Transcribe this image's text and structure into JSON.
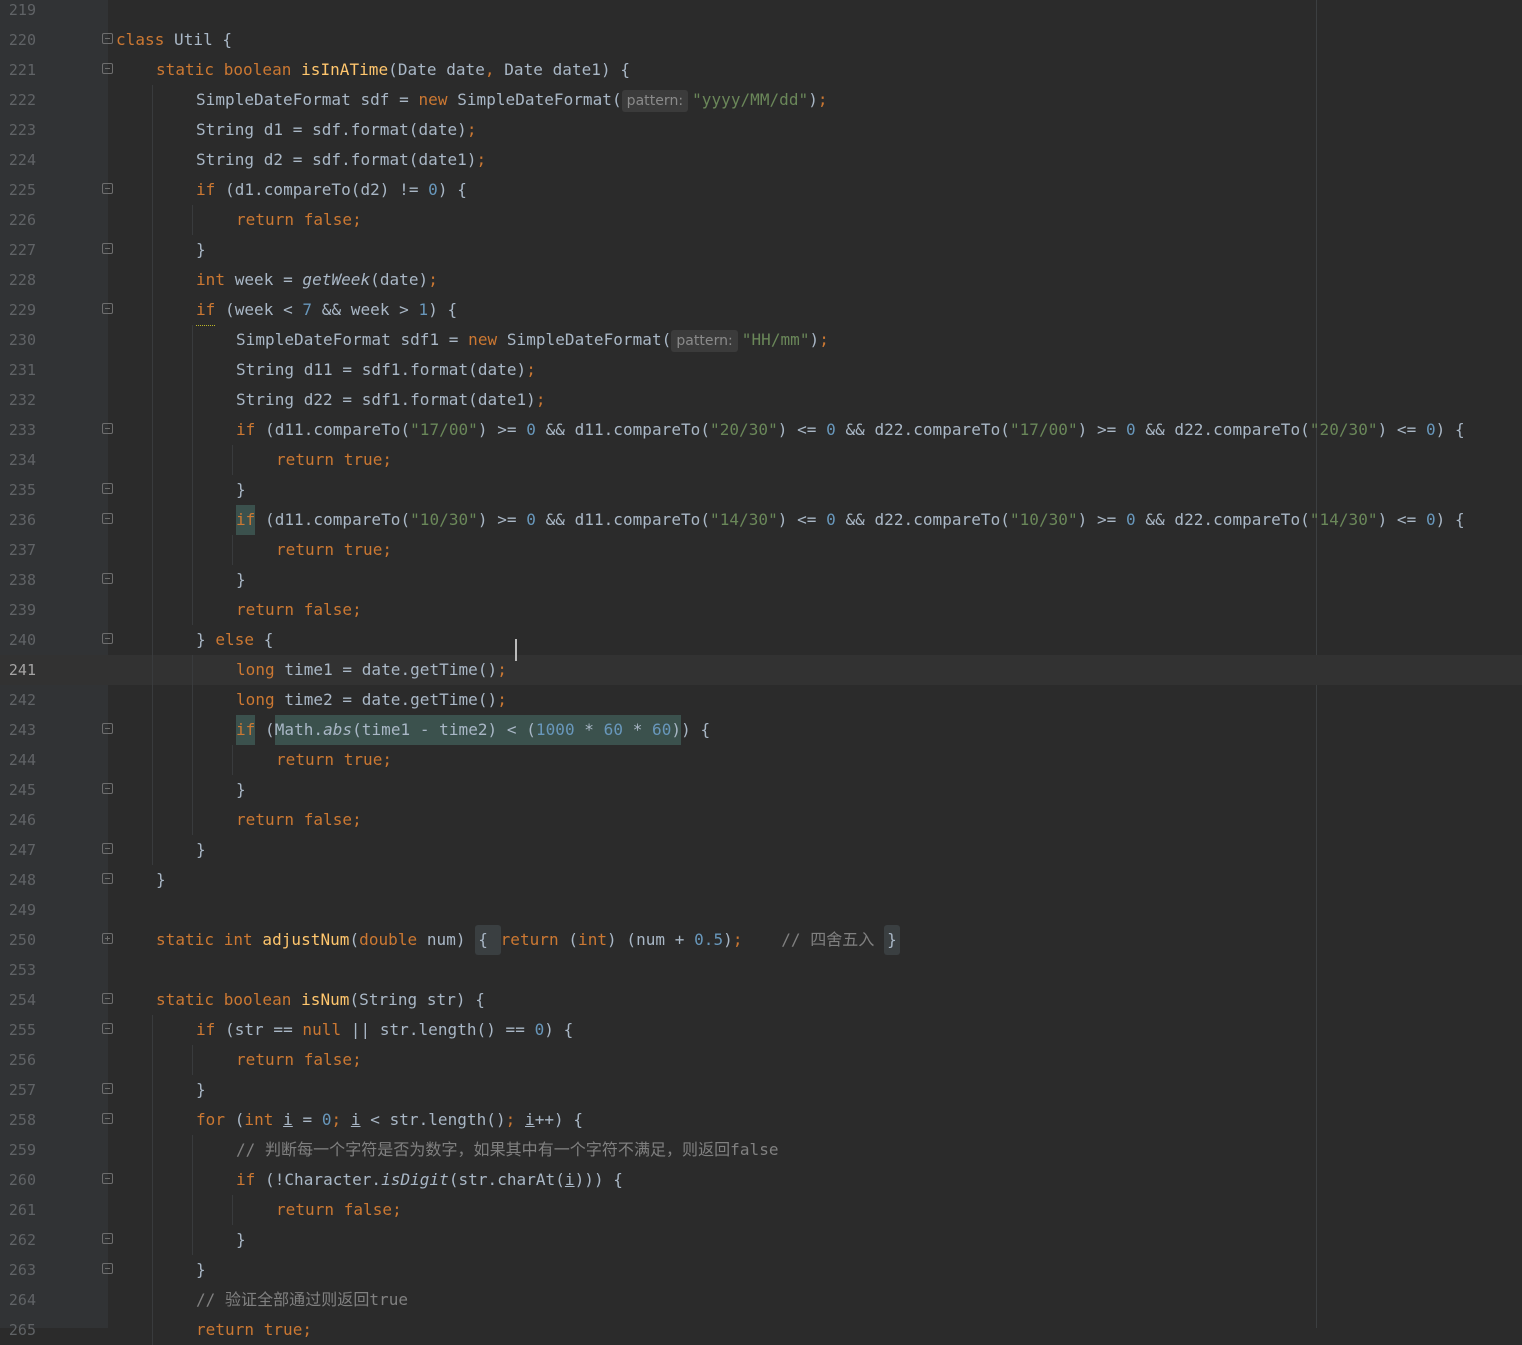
{
  "gutter_start_line": "219",
  "lines": [
    {
      "n": "219",
      "indent": 0,
      "fold": "",
      "tokens": [
        {
          "t": "",
          "c": "plain"
        }
      ]
    },
    {
      "n": "220",
      "indent": 0,
      "fold": "start",
      "tokens": [
        {
          "t": "class ",
          "c": "kw"
        },
        {
          "t": "Util {",
          "c": "plain"
        }
      ]
    },
    {
      "n": "221",
      "indent": 1,
      "fold": "start",
      "tokens": [
        {
          "t": "static boolean ",
          "c": "kw"
        },
        {
          "t": "isInATime",
          "c": "fn"
        },
        {
          "t": "(Date date",
          "c": "plain"
        },
        {
          "t": ", ",
          "c": "kw"
        },
        {
          "t": "Date date1) {",
          "c": "plain"
        }
      ]
    },
    {
      "n": "222",
      "indent": 2,
      "fold": "",
      "tokens": [
        {
          "t": "SimpleDateFormat sdf = ",
          "c": "plain"
        },
        {
          "t": "new ",
          "c": "kw"
        },
        {
          "t": "SimpleDateFormat(",
          "c": "plain"
        },
        {
          "t": "pattern:",
          "c": "hint"
        },
        {
          "t": "\"yyyy/MM/dd\"",
          "c": "str"
        },
        {
          "t": ")",
          "c": "plain"
        },
        {
          "t": ";",
          "c": "kw"
        }
      ]
    },
    {
      "n": "223",
      "indent": 2,
      "fold": "",
      "tokens": [
        {
          "t": "String d1 = sdf.format(date)",
          "c": "plain"
        },
        {
          "t": ";",
          "c": "kw"
        }
      ]
    },
    {
      "n": "224",
      "indent": 2,
      "fold": "",
      "tokens": [
        {
          "t": "String d2 = sdf.format(date1)",
          "c": "plain"
        },
        {
          "t": ";",
          "c": "kw"
        }
      ]
    },
    {
      "n": "225",
      "indent": 2,
      "fold": "start",
      "tokens": [
        {
          "t": "if ",
          "c": "kw"
        },
        {
          "t": "(d1.compareTo(d2) != ",
          "c": "plain"
        },
        {
          "t": "0",
          "c": "num"
        },
        {
          "t": ") {",
          "c": "plain"
        }
      ]
    },
    {
      "n": "226",
      "indent": 3,
      "fold": "",
      "tokens": [
        {
          "t": "return false",
          "c": "kw"
        },
        {
          "t": ";",
          "c": "kw"
        }
      ]
    },
    {
      "n": "227",
      "indent": 2,
      "fold": "end",
      "tokens": [
        {
          "t": "}",
          "c": "plain"
        }
      ]
    },
    {
      "n": "228",
      "indent": 2,
      "fold": "",
      "tokens": [
        {
          "t": "int ",
          "c": "kw"
        },
        {
          "t": "week = ",
          "c": "plain"
        },
        {
          "t": "getWeek",
          "c": "st"
        },
        {
          "t": "(date)",
          "c": "plain"
        },
        {
          "t": ";",
          "c": "kw"
        }
      ]
    },
    {
      "n": "229",
      "indent": 2,
      "fold": "start",
      "tokens": [
        {
          "t": "if",
          "c": "warn"
        },
        {
          "t": " (week < ",
          "c": "plain"
        },
        {
          "t": "7 ",
          "c": "num"
        },
        {
          "t": "&& week > ",
          "c": "plain"
        },
        {
          "t": "1",
          "c": "num"
        },
        {
          "t": ") {",
          "c": "plain"
        }
      ]
    },
    {
      "n": "230",
      "indent": 3,
      "fold": "",
      "tokens": [
        {
          "t": "SimpleDateFormat sdf1 = ",
          "c": "plain"
        },
        {
          "t": "new ",
          "c": "kw"
        },
        {
          "t": "SimpleDateFormat(",
          "c": "plain"
        },
        {
          "t": "pattern:",
          "c": "hint"
        },
        {
          "t": "\"HH/mm\"",
          "c": "str"
        },
        {
          "t": ")",
          "c": "plain"
        },
        {
          "t": ";",
          "c": "kw"
        }
      ]
    },
    {
      "n": "231",
      "indent": 3,
      "fold": "",
      "tokens": [
        {
          "t": "String d11 = sdf1.format(date)",
          "c": "plain"
        },
        {
          "t": ";",
          "c": "kw"
        }
      ]
    },
    {
      "n": "232",
      "indent": 3,
      "fold": "",
      "tokens": [
        {
          "t": "String d22 = sdf1.format(date1)",
          "c": "plain"
        },
        {
          "t": ";",
          "c": "kw"
        }
      ]
    },
    {
      "n": "233",
      "indent": 3,
      "fold": "start",
      "tokens": [
        {
          "t": "if ",
          "c": "kw"
        },
        {
          "t": "(d11.compareTo(",
          "c": "plain"
        },
        {
          "t": "\"17/00\"",
          "c": "str"
        },
        {
          "t": ") >= ",
          "c": "plain"
        },
        {
          "t": "0 ",
          "c": "num"
        },
        {
          "t": "&& d11.compareTo(",
          "c": "plain"
        },
        {
          "t": "\"20/30\"",
          "c": "str"
        },
        {
          "t": ") <= ",
          "c": "plain"
        },
        {
          "t": "0 ",
          "c": "num"
        },
        {
          "t": "&& d22.compareTo(",
          "c": "plain"
        },
        {
          "t": "\"17/00\"",
          "c": "str"
        },
        {
          "t": ") >= ",
          "c": "plain"
        },
        {
          "t": "0 ",
          "c": "num"
        },
        {
          "t": "&& d22.compareTo(",
          "c": "plain"
        },
        {
          "t": "\"20/30\"",
          "c": "str"
        },
        {
          "t": ") <= ",
          "c": "plain"
        },
        {
          "t": "0",
          "c": "num"
        },
        {
          "t": ") {",
          "c": "plain"
        }
      ]
    },
    {
      "n": "234",
      "indent": 4,
      "fold": "",
      "tokens": [
        {
          "t": "return true",
          "c": "kw"
        },
        {
          "t": ";",
          "c": "kw"
        }
      ]
    },
    {
      "n": "235",
      "indent": 3,
      "fold": "end",
      "tokens": [
        {
          "t": "}",
          "c": "plain"
        }
      ]
    },
    {
      "n": "236",
      "indent": 3,
      "fold": "start",
      "tokens": [
        {
          "t": "if",
          "c": "hlkw"
        },
        {
          "t": " (d11.compareTo(",
          "c": "plain"
        },
        {
          "t": "\"10/30\"",
          "c": "str"
        },
        {
          "t": ") >= ",
          "c": "plain"
        },
        {
          "t": "0 ",
          "c": "num"
        },
        {
          "t": "&& d11.compareTo(",
          "c": "plain"
        },
        {
          "t": "\"14/30\"",
          "c": "str"
        },
        {
          "t": ") <= ",
          "c": "plain"
        },
        {
          "t": "0 ",
          "c": "num"
        },
        {
          "t": "&& d22.compareTo(",
          "c": "plain"
        },
        {
          "t": "\"10/30\"",
          "c": "str"
        },
        {
          "t": ") >= ",
          "c": "plain"
        },
        {
          "t": "0 ",
          "c": "num"
        },
        {
          "t": "&& d22.compareTo(",
          "c": "plain"
        },
        {
          "t": "\"14/30\"",
          "c": "str"
        },
        {
          "t": ") <= ",
          "c": "plain"
        },
        {
          "t": "0",
          "c": "num"
        },
        {
          "t": ") {",
          "c": "plain"
        }
      ]
    },
    {
      "n": "237",
      "indent": 4,
      "fold": "",
      "tokens": [
        {
          "t": "return true",
          "c": "kw"
        },
        {
          "t": ";",
          "c": "kw"
        }
      ]
    },
    {
      "n": "238",
      "indent": 3,
      "fold": "end",
      "tokens": [
        {
          "t": "}",
          "c": "plain"
        }
      ]
    },
    {
      "n": "239",
      "indent": 3,
      "fold": "",
      "tokens": [
        {
          "t": "return false",
          "c": "kw"
        },
        {
          "t": ";",
          "c": "kw"
        }
      ]
    },
    {
      "n": "240",
      "indent": 2,
      "fold": "start",
      "tokens": [
        {
          "t": "} ",
          "c": "plain"
        },
        {
          "t": "else ",
          "c": "kw"
        },
        {
          "t": "{",
          "c": "plain"
        }
      ]
    },
    {
      "n": "241",
      "indent": 3,
      "fold": "",
      "current": true,
      "tokens": [
        {
          "t": "long ",
          "c": "kw"
        },
        {
          "t": "time1 = date.getTime()",
          "c": "plain"
        },
        {
          "t": ";",
          "c": "kw"
        }
      ]
    },
    {
      "n": "242",
      "indent": 3,
      "fold": "",
      "tokens": [
        {
          "t": "long ",
          "c": "kw"
        },
        {
          "t": "time2 = date.getTime()",
          "c": "plain"
        },
        {
          "t": ";",
          "c": "kw"
        }
      ]
    },
    {
      "n": "243",
      "indent": 3,
      "fold": "start",
      "tokens": [
        {
          "t": "if",
          "c": "hlkw"
        },
        {
          "t": " (",
          "c": "plain"
        },
        {
          "t": "Math.",
          "c": "hl"
        },
        {
          "t": "abs",
          "c": "hlst"
        },
        {
          "t": "(time1 - time2) < (",
          "c": "hl"
        },
        {
          "t": "1000 ",
          "c": "hln"
        },
        {
          "t": "* ",
          "c": "hl"
        },
        {
          "t": "60 ",
          "c": "hln"
        },
        {
          "t": "* ",
          "c": "hl"
        },
        {
          "t": "60",
          "c": "hln"
        },
        {
          "t": ")",
          "c": "hl"
        },
        {
          "t": ") {",
          "c": "plain"
        }
      ]
    },
    {
      "n": "244",
      "indent": 4,
      "fold": "",
      "tokens": [
        {
          "t": "return true",
          "c": "kw"
        },
        {
          "t": ";",
          "c": "kw"
        }
      ]
    },
    {
      "n": "245",
      "indent": 3,
      "fold": "end",
      "tokens": [
        {
          "t": "}",
          "c": "plain"
        }
      ]
    },
    {
      "n": "246",
      "indent": 3,
      "fold": "",
      "tokens": [
        {
          "t": "return false",
          "c": "kw"
        },
        {
          "t": ";",
          "c": "kw"
        }
      ]
    },
    {
      "n": "247",
      "indent": 2,
      "fold": "end",
      "tokens": [
        {
          "t": "}",
          "c": "plain"
        }
      ]
    },
    {
      "n": "248",
      "indent": 1,
      "fold": "end",
      "tokens": [
        {
          "t": "}",
          "c": "plain"
        }
      ]
    },
    {
      "n": "249",
      "indent": 0,
      "fold": "",
      "tokens": [
        {
          "t": "",
          "c": "plain"
        }
      ]
    },
    {
      "n": "250",
      "indent": 1,
      "fold": "collapsed",
      "tokens": [
        {
          "t": "static int ",
          "c": "kw"
        },
        {
          "t": "adjustNum",
          "c": "fn"
        },
        {
          "t": "(",
          "c": "plain"
        },
        {
          "t": "double ",
          "c": "kw"
        },
        {
          "t": "num) ",
          "c": "plain"
        },
        {
          "t": "{ ",
          "c": "fold"
        },
        {
          "t": "return ",
          "c": "kw"
        },
        {
          "t": "(",
          "c": "plain"
        },
        {
          "t": "int",
          "c": "kw"
        },
        {
          "t": ") (num + ",
          "c": "plain"
        },
        {
          "t": "0.5",
          "c": "num"
        },
        {
          "t": ")",
          "c": "plain"
        },
        {
          "t": ";    ",
          "c": "kw"
        },
        {
          "t": "// 四舍五入 ",
          "c": "comment"
        },
        {
          "t": "}",
          "c": "fold"
        }
      ]
    },
    {
      "n": "253",
      "indent": 0,
      "fold": "",
      "tokens": [
        {
          "t": "",
          "c": "plain"
        }
      ]
    },
    {
      "n": "254",
      "indent": 1,
      "fold": "start",
      "tokens": [
        {
          "t": "static boolean ",
          "c": "kw"
        },
        {
          "t": "isNum",
          "c": "fn"
        },
        {
          "t": "(String str) {",
          "c": "plain"
        }
      ]
    },
    {
      "n": "255",
      "indent": 2,
      "fold": "start",
      "tokens": [
        {
          "t": "if ",
          "c": "kw"
        },
        {
          "t": "(str == ",
          "c": "plain"
        },
        {
          "t": "null ",
          "c": "kw"
        },
        {
          "t": "|| str.length() == ",
          "c": "plain"
        },
        {
          "t": "0",
          "c": "num"
        },
        {
          "t": ") {",
          "c": "plain"
        }
      ]
    },
    {
      "n": "256",
      "indent": 3,
      "fold": "",
      "tokens": [
        {
          "t": "return false",
          "c": "kw"
        },
        {
          "t": ";",
          "c": "kw"
        }
      ]
    },
    {
      "n": "257",
      "indent": 2,
      "fold": "end",
      "tokens": [
        {
          "t": "}",
          "c": "plain"
        }
      ]
    },
    {
      "n": "258",
      "indent": 2,
      "fold": "start",
      "tokens": [
        {
          "t": "for ",
          "c": "kw"
        },
        {
          "t": "(",
          "c": "plain"
        },
        {
          "t": "int ",
          "c": "kw"
        },
        {
          "t": "i",
          "c": "uvar"
        },
        {
          "t": " = ",
          "c": "plain"
        },
        {
          "t": "0",
          "c": "num"
        },
        {
          "t": "; ",
          "c": "kw"
        },
        {
          "t": "i",
          "c": "uvar"
        },
        {
          "t": " < str.length()",
          "c": "plain"
        },
        {
          "t": "; ",
          "c": "kw"
        },
        {
          "t": "i",
          "c": "uvar"
        },
        {
          "t": "++) {",
          "c": "plain"
        }
      ]
    },
    {
      "n": "259",
      "indent": 3,
      "fold": "",
      "tokens": [
        {
          "t": "// 判断每一个字符是否为数字，如果其中有一个字符不满足，则返回false",
          "c": "comment"
        }
      ]
    },
    {
      "n": "260",
      "indent": 3,
      "fold": "start",
      "tokens": [
        {
          "t": "if ",
          "c": "kw"
        },
        {
          "t": "(!Character.",
          "c": "plain"
        },
        {
          "t": "isDigit",
          "c": "st"
        },
        {
          "t": "(str.charAt(",
          "c": "plain"
        },
        {
          "t": "i",
          "c": "uvar"
        },
        {
          "t": "))) {",
          "c": "plain"
        }
      ]
    },
    {
      "n": "261",
      "indent": 4,
      "fold": "",
      "tokens": [
        {
          "t": "return false",
          "c": "kw"
        },
        {
          "t": ";",
          "c": "kw"
        }
      ]
    },
    {
      "n": "262",
      "indent": 3,
      "fold": "end",
      "tokens": [
        {
          "t": "}",
          "c": "plain"
        }
      ]
    },
    {
      "n": "263",
      "indent": 2,
      "fold": "end",
      "tokens": [
        {
          "t": "}",
          "c": "plain"
        }
      ]
    },
    {
      "n": "264",
      "indent": 2,
      "fold": "",
      "tokens": [
        {
          "t": "// 验证全部通过则返回true",
          "c": "comment"
        }
      ]
    },
    {
      "n": "265",
      "indent": 2,
      "fold": "",
      "tokens": [
        {
          "t": "return true",
          "c": "kw"
        },
        {
          "t": ";",
          "c": "kw"
        }
      ]
    }
  ]
}
